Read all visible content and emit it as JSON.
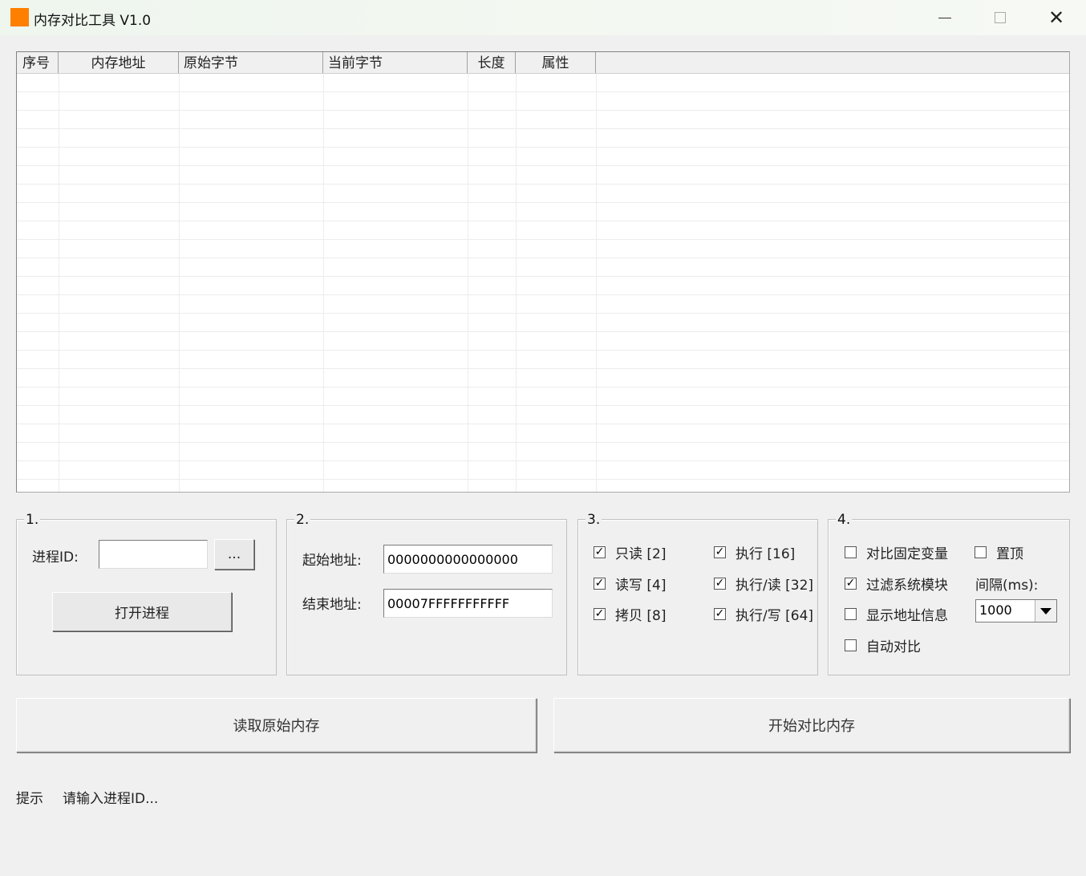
{
  "window": {
    "title": "内存对比工具 V1.0",
    "icon_color": "#ff7f00"
  },
  "listview": {
    "columns": [
      "序号",
      "内存地址",
      "原始字节",
      "当前字节",
      "长度",
      "属性"
    ]
  },
  "group1": {
    "legend": "1.",
    "pid_label": "进程ID:",
    "pid_value": "",
    "browse_label": "...",
    "open_label": "打开进程"
  },
  "group2": {
    "legend": "2.",
    "start_label": "起始地址:",
    "start_value": "0000000000000000",
    "end_label": "结束地址:",
    "end_value": "00007FFFFFFFFFFF"
  },
  "group3": {
    "legend": "3.",
    "checks": [
      {
        "label": "只读 [2]",
        "checked": true
      },
      {
        "label": "执行 [16]",
        "checked": true
      },
      {
        "label": "读写 [4]",
        "checked": true
      },
      {
        "label": "执行/读 [32]",
        "checked": true
      },
      {
        "label": "拷贝 [8]",
        "checked": true
      },
      {
        "label": "执行/写 [64]",
        "checked": true
      }
    ]
  },
  "group4": {
    "legend": "4.",
    "compare_fixed": {
      "label": "对比固定变量",
      "checked": false
    },
    "topmost": {
      "label": "置顶",
      "checked": false
    },
    "filter_sys": {
      "label": "过滤系统模块",
      "checked": true
    },
    "interval_label": "间隔(ms):",
    "show_addr": {
      "label": "显示地址信息",
      "checked": false
    },
    "interval_value": "1000",
    "auto_compare": {
      "label": "自动对比",
      "checked": false
    }
  },
  "actions": {
    "read_label": "读取原始内存",
    "compare_label": "开始对比内存"
  },
  "status": {
    "label": "提示",
    "message": "请输入进程ID..."
  }
}
